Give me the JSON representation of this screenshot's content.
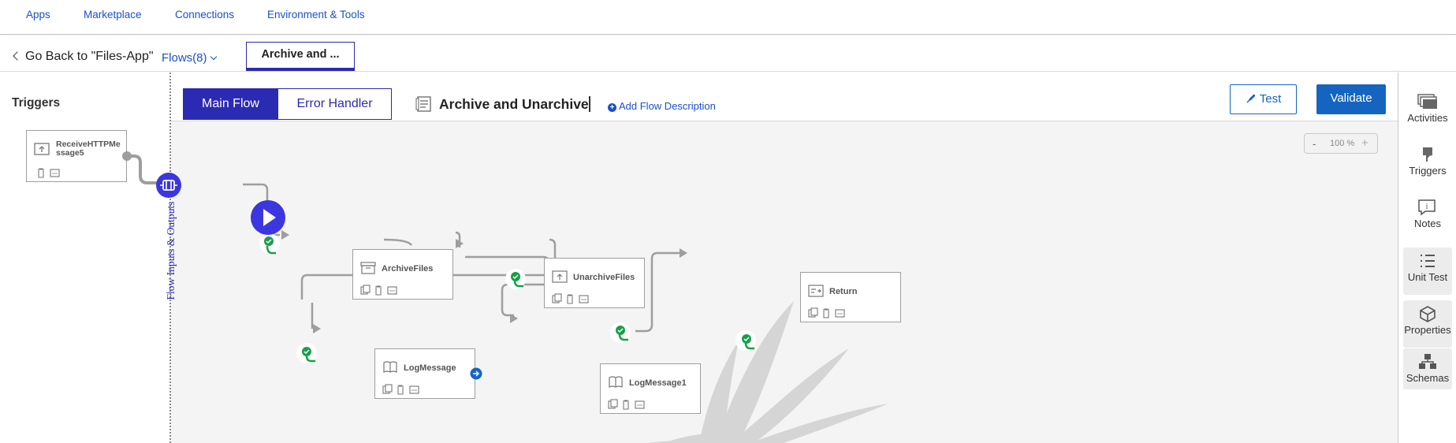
{
  "topnav": {
    "items": [
      "Apps",
      "Marketplace",
      "Connections",
      "Environment & Tools"
    ]
  },
  "subbar": {
    "back_label": "Go Back to \"Files-App\"",
    "flows_label": "Flows(8)",
    "active_tab": "Archive and ..."
  },
  "triggers": {
    "title": "Triggers",
    "trigger_node": {
      "label_line1": "ReceiveHTTPMe",
      "label_line2": "ssage5"
    }
  },
  "flow_io_label": "Flow Inputs & Outputs",
  "canvas": {
    "segments": {
      "main": "Main Flow",
      "error": "Error Handler"
    },
    "flow_title": "Archive and Unarchive",
    "add_description": "Add Flow Description",
    "test_label": "Test",
    "validate_label": "Validate",
    "zoom": {
      "minus": "-",
      "value": "100 %",
      "plus": "+"
    },
    "nodes": {
      "archive": "ArchiveFiles",
      "unarchive": "UnarchiveFiles",
      "return": "Return",
      "log": "LogMessage",
      "log1": "LogMessage1"
    }
  },
  "sidepanel": {
    "activities": "Activities",
    "triggers": "Triggers",
    "notes": "Notes",
    "unit_test": "Unit Test",
    "properties": "Properties",
    "schemas": "Schemas"
  },
  "colors": {
    "primary": "#2b2ab2",
    "link": "#1b4fcf",
    "button": "#1565c0",
    "success": "#18a04a",
    "connector": "#9e9e9e"
  }
}
